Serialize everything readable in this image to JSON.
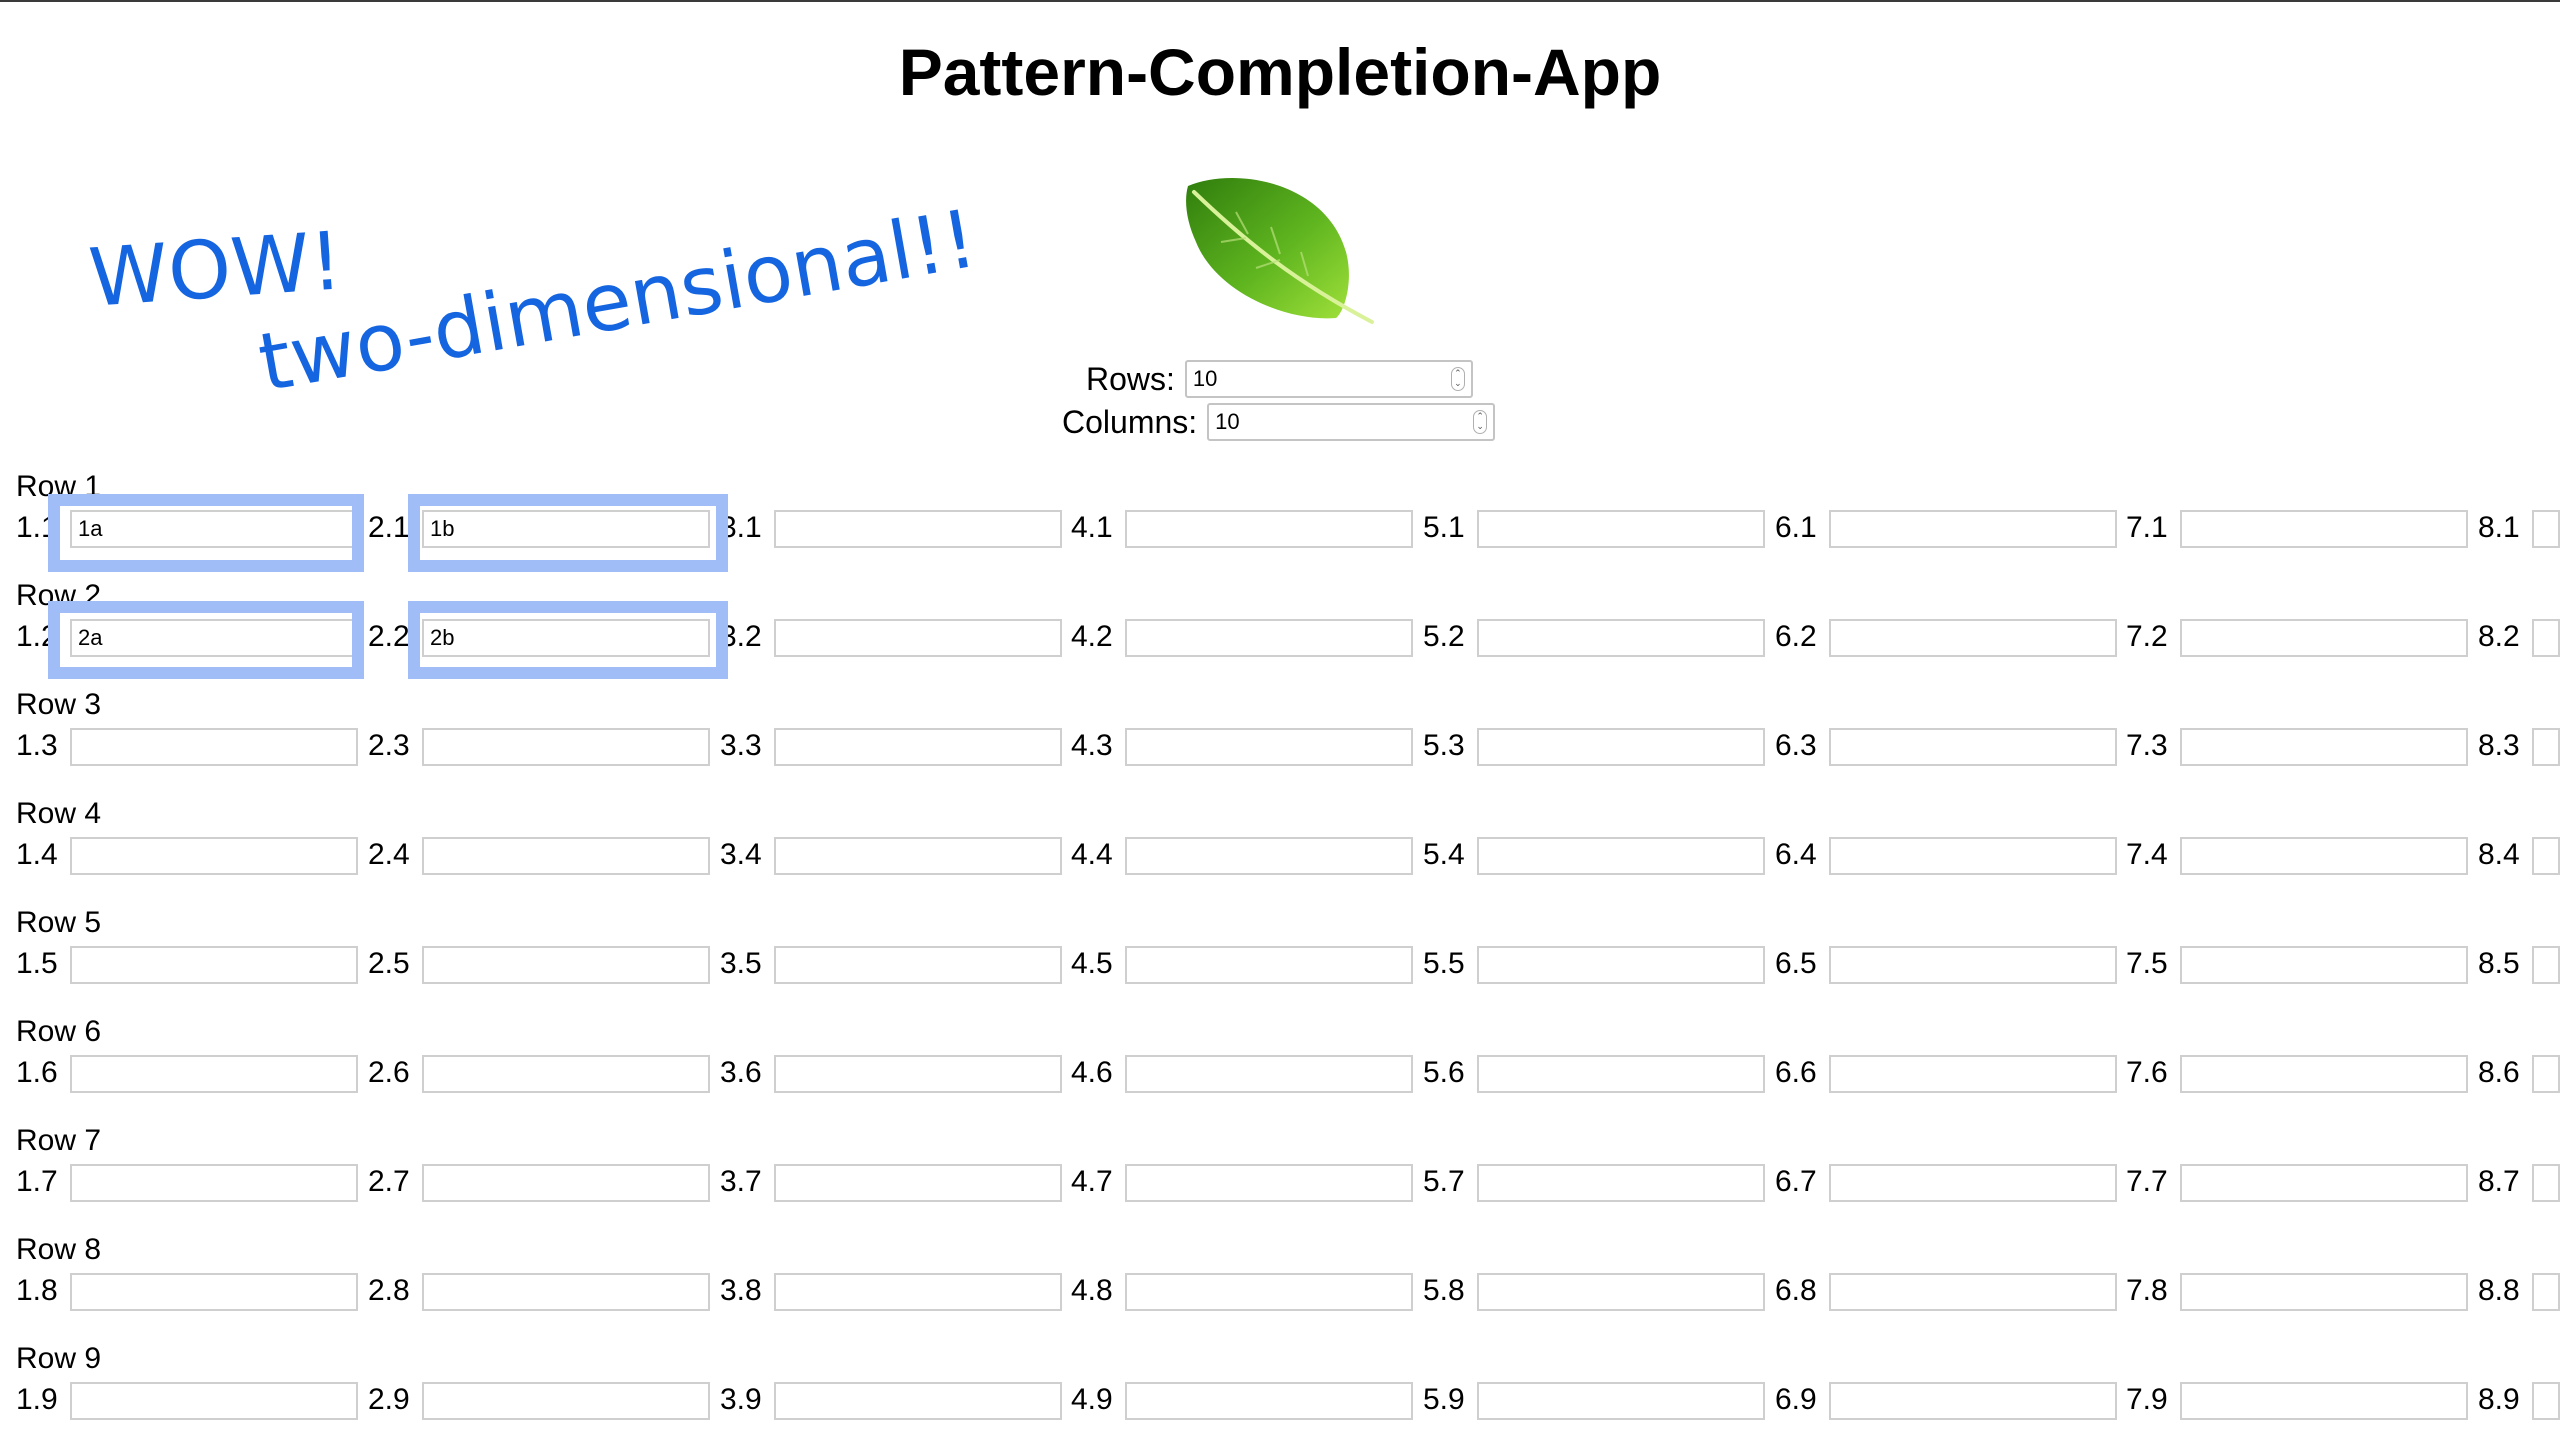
{
  "app": {
    "title": "Pattern-Completion-App"
  },
  "logo": {
    "icon": "leaf-icon"
  },
  "controls": {
    "rows_label": "Rows:",
    "rows_value": "10",
    "columns_label": "Columns:",
    "columns_value": "10"
  },
  "annotations": {
    "wow": "WOW!",
    "two_dimensional": "two-dimensional!!"
  },
  "grid": {
    "rows": [
      {
        "label": "Row 1",
        "cells": [
          {
            "label": "1.1",
            "value": "1a"
          },
          {
            "label": "2.1",
            "value": "1b"
          },
          {
            "label": "3.1",
            "value": ""
          },
          {
            "label": "4.1",
            "value": ""
          },
          {
            "label": "5.1",
            "value": ""
          },
          {
            "label": "6.1",
            "value": ""
          },
          {
            "label": "7.1",
            "value": ""
          },
          {
            "label": "8.1",
            "value": ""
          }
        ]
      },
      {
        "label": "Row 2",
        "cells": [
          {
            "label": "1.2",
            "value": "2a"
          },
          {
            "label": "2.2",
            "value": "2b"
          },
          {
            "label": "3.2",
            "value": ""
          },
          {
            "label": "4.2",
            "value": ""
          },
          {
            "label": "5.2",
            "value": ""
          },
          {
            "label": "6.2",
            "value": ""
          },
          {
            "label": "7.2",
            "value": ""
          },
          {
            "label": "8.2",
            "value": ""
          }
        ]
      },
      {
        "label": "Row 3",
        "cells": [
          {
            "label": "1.3",
            "value": ""
          },
          {
            "label": "2.3",
            "value": ""
          },
          {
            "label": "3.3",
            "value": ""
          },
          {
            "label": "4.3",
            "value": ""
          },
          {
            "label": "5.3",
            "value": ""
          },
          {
            "label": "6.3",
            "value": ""
          },
          {
            "label": "7.3",
            "value": ""
          },
          {
            "label": "8.3",
            "value": ""
          }
        ]
      },
      {
        "label": "Row 4",
        "cells": [
          {
            "label": "1.4",
            "value": ""
          },
          {
            "label": "2.4",
            "value": ""
          },
          {
            "label": "3.4",
            "value": ""
          },
          {
            "label": "4.4",
            "value": ""
          },
          {
            "label": "5.4",
            "value": ""
          },
          {
            "label": "6.4",
            "value": ""
          },
          {
            "label": "7.4",
            "value": ""
          },
          {
            "label": "8.4",
            "value": ""
          }
        ]
      },
      {
        "label": "Row 5",
        "cells": [
          {
            "label": "1.5",
            "value": ""
          },
          {
            "label": "2.5",
            "value": ""
          },
          {
            "label": "3.5",
            "value": ""
          },
          {
            "label": "4.5",
            "value": ""
          },
          {
            "label": "5.5",
            "value": ""
          },
          {
            "label": "6.5",
            "value": ""
          },
          {
            "label": "7.5",
            "value": ""
          },
          {
            "label": "8.5",
            "value": ""
          }
        ]
      },
      {
        "label": "Row 6",
        "cells": [
          {
            "label": "1.6",
            "value": ""
          },
          {
            "label": "2.6",
            "value": ""
          },
          {
            "label": "3.6",
            "value": ""
          },
          {
            "label": "4.6",
            "value": ""
          },
          {
            "label": "5.6",
            "value": ""
          },
          {
            "label": "6.6",
            "value": ""
          },
          {
            "label": "7.6",
            "value": ""
          },
          {
            "label": "8.6",
            "value": ""
          }
        ]
      },
      {
        "label": "Row 7",
        "cells": [
          {
            "label": "1.7",
            "value": ""
          },
          {
            "label": "2.7",
            "value": ""
          },
          {
            "label": "3.7",
            "value": ""
          },
          {
            "label": "4.7",
            "value": ""
          },
          {
            "label": "5.7",
            "value": ""
          },
          {
            "label": "6.7",
            "value": ""
          },
          {
            "label": "7.7",
            "value": ""
          },
          {
            "label": "8.7",
            "value": ""
          }
        ]
      },
      {
        "label": "Row 8",
        "cells": [
          {
            "label": "1.8",
            "value": ""
          },
          {
            "label": "2.8",
            "value": ""
          },
          {
            "label": "3.8",
            "value": ""
          },
          {
            "label": "4.8",
            "value": ""
          },
          {
            "label": "5.8",
            "value": ""
          },
          {
            "label": "6.8",
            "value": ""
          },
          {
            "label": "7.8",
            "value": ""
          },
          {
            "label": "8.8",
            "value": ""
          }
        ]
      },
      {
        "label": "Row 9",
        "cells": [
          {
            "label": "1.9",
            "value": ""
          },
          {
            "label": "2.9",
            "value": ""
          },
          {
            "label": "3.9",
            "value": ""
          },
          {
            "label": "4.9",
            "value": ""
          },
          {
            "label": "5.9",
            "value": ""
          },
          {
            "label": "6.9",
            "value": ""
          },
          {
            "label": "7.9",
            "value": ""
          },
          {
            "label": "8.9",
            "value": ""
          }
        ]
      }
    ]
  },
  "colors": {
    "annotation": "#1565e0",
    "highlight": "#a0bdf8",
    "input_border": "#cfcfcf"
  }
}
